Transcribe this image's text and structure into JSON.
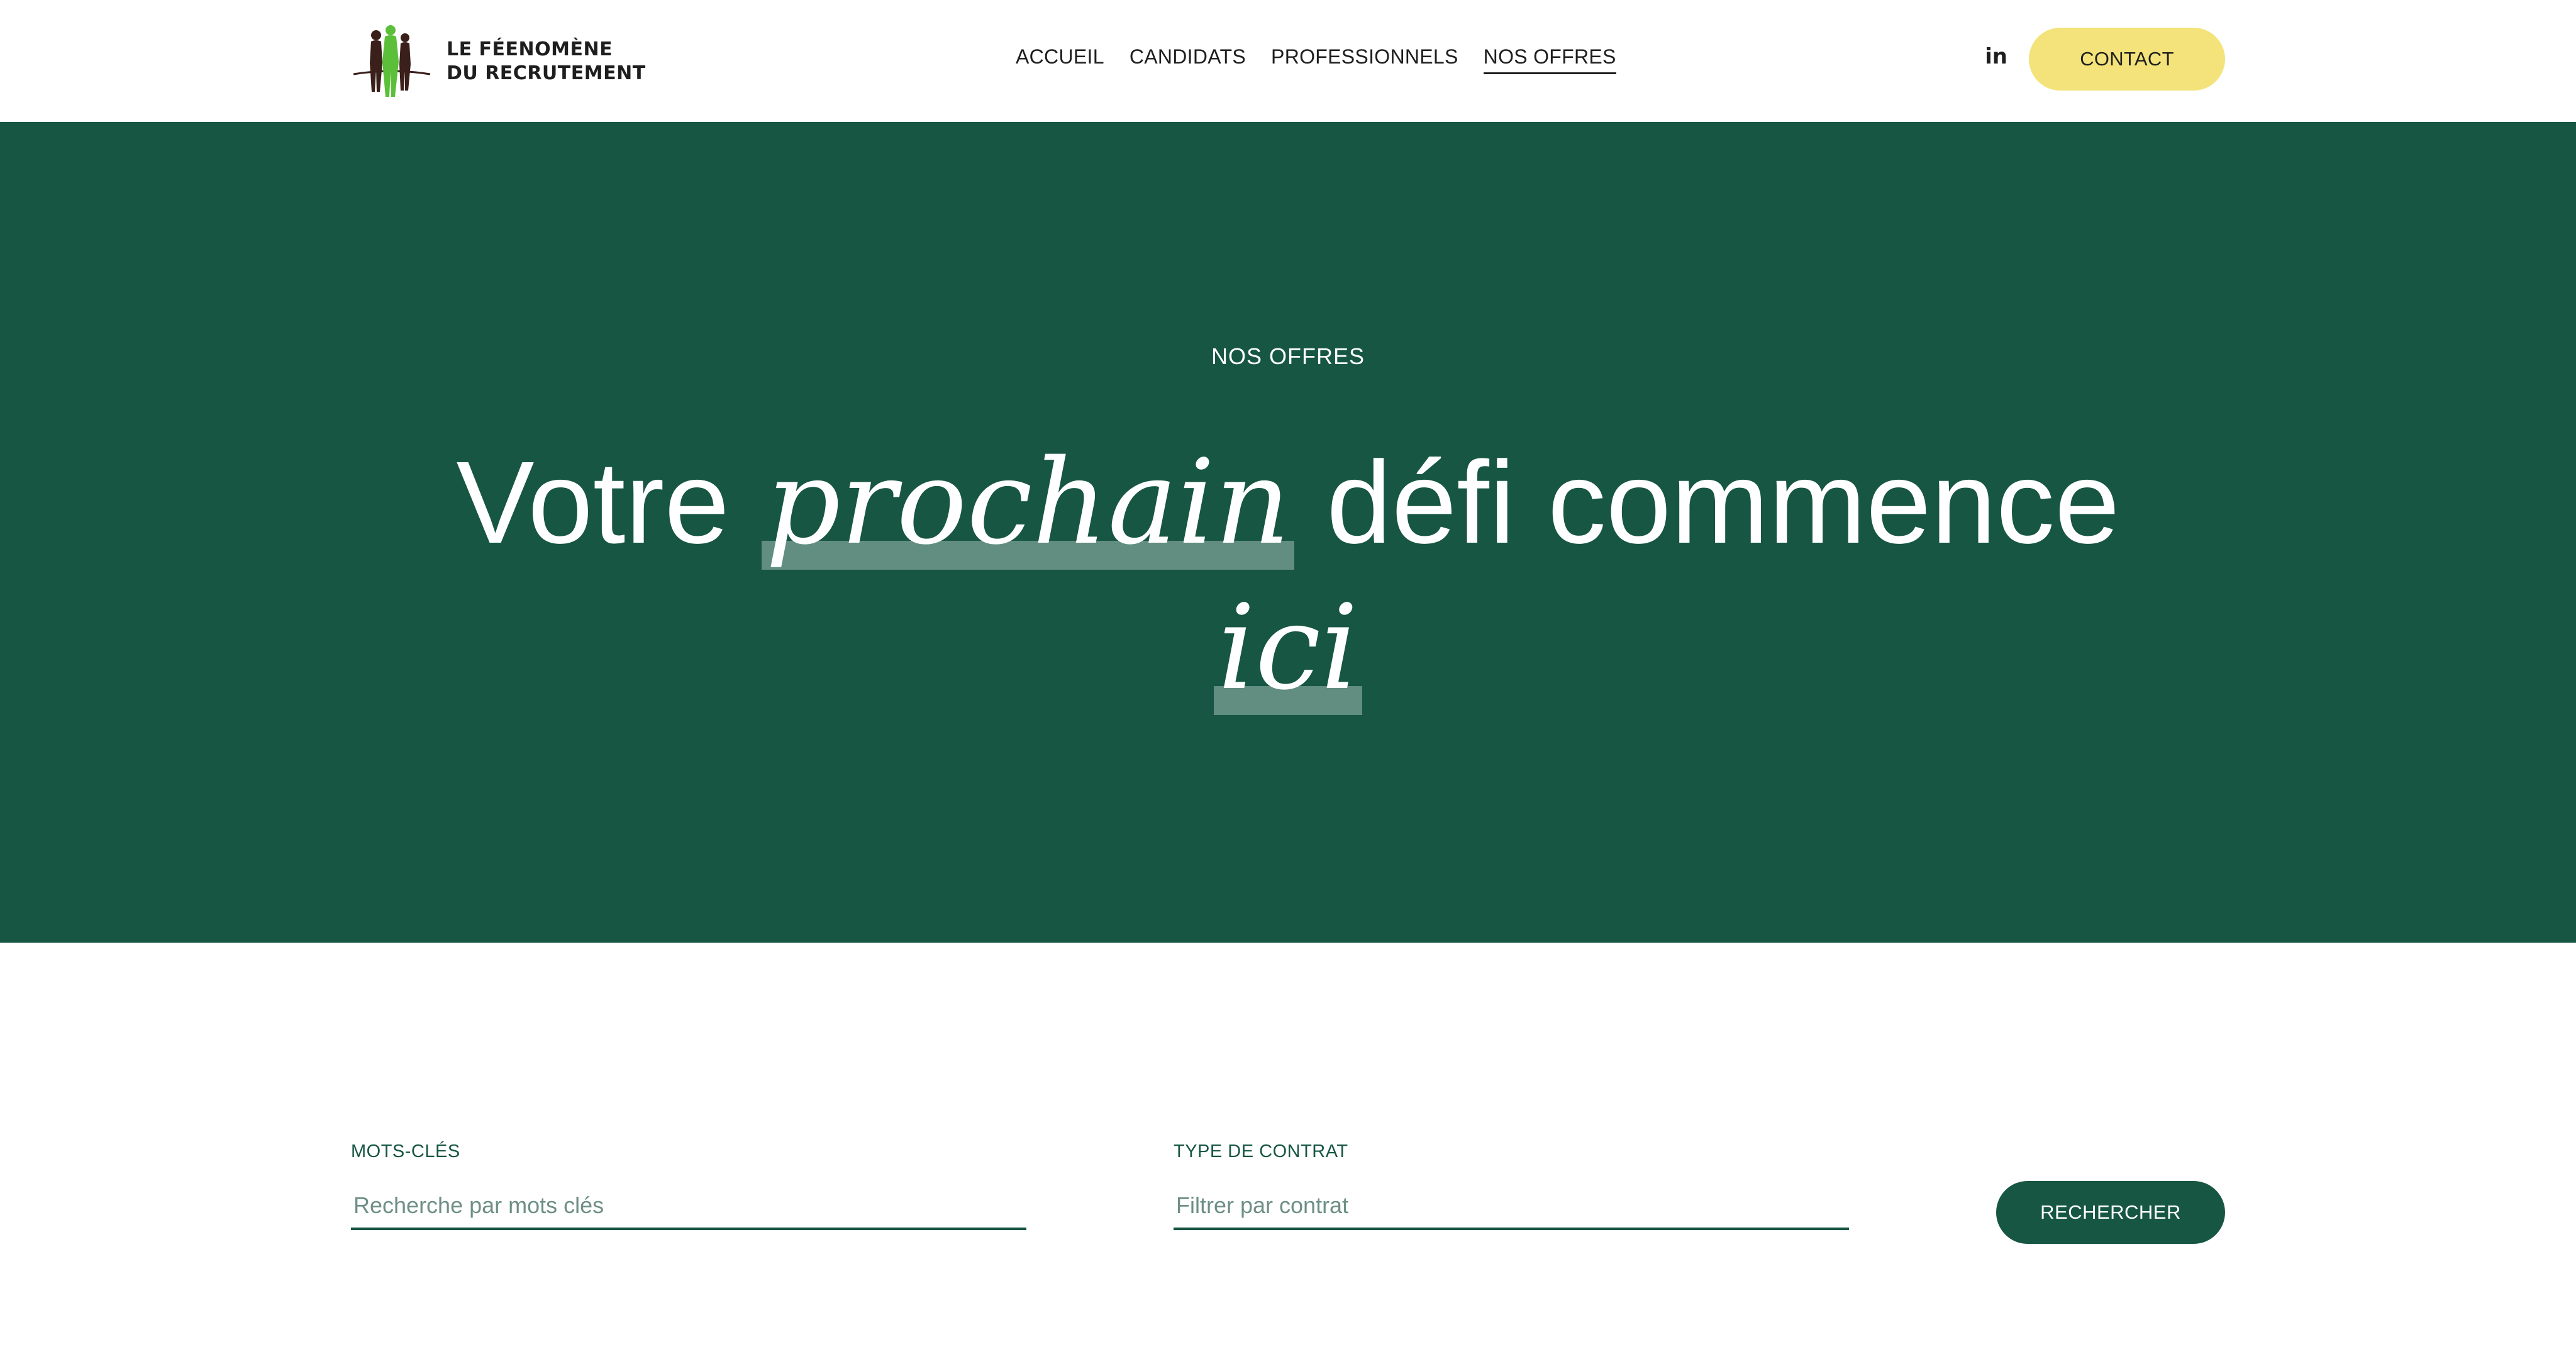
{
  "header": {
    "logo": {
      "line1": "LE FÉENOMÈNE",
      "line2": "DU RECRUTEMENT"
    },
    "nav": [
      {
        "label": "ACCUEIL"
      },
      {
        "label": "CANDIDATS"
      },
      {
        "label": "PROFESSIONNELS"
      },
      {
        "label": "NOS OFFRES",
        "active": true
      }
    ],
    "linkedin": "in",
    "contact": "CONTACT"
  },
  "hero": {
    "eyebrow": "NOS OFFRES",
    "title_part1": "Votre",
    "title_highlight1": "prochain",
    "title_part2": "défi commence",
    "title_highlight2": "ici"
  },
  "search": {
    "keywords_label": "MOTS-CLÉS",
    "keywords_placeholder": "Recherche par mots clés",
    "contract_label": "TYPE DE CONTRAT",
    "contract_placeholder": "Filtrer par contrat",
    "submit": "RECHERCHER"
  },
  "colors": {
    "primary_green": "#165643",
    "accent_yellow": "#f3e37a",
    "logo_green": "#5cbf3a",
    "logo_brown": "#3a1f1a"
  }
}
